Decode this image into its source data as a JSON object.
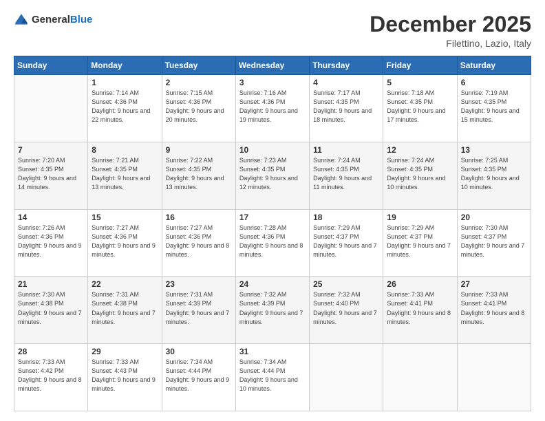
{
  "header": {
    "logo_general": "General",
    "logo_blue": "Blue",
    "month": "December 2025",
    "location": "Filettino, Lazio, Italy"
  },
  "days_of_week": [
    "Sunday",
    "Monday",
    "Tuesday",
    "Wednesday",
    "Thursday",
    "Friday",
    "Saturday"
  ],
  "weeks": [
    [
      {
        "day": "",
        "sunrise": "",
        "sunset": "",
        "daylight": ""
      },
      {
        "day": "1",
        "sunrise": "Sunrise: 7:14 AM",
        "sunset": "Sunset: 4:36 PM",
        "daylight": "Daylight: 9 hours and 22 minutes."
      },
      {
        "day": "2",
        "sunrise": "Sunrise: 7:15 AM",
        "sunset": "Sunset: 4:36 PM",
        "daylight": "Daylight: 9 hours and 20 minutes."
      },
      {
        "day": "3",
        "sunrise": "Sunrise: 7:16 AM",
        "sunset": "Sunset: 4:36 PM",
        "daylight": "Daylight: 9 hours and 19 minutes."
      },
      {
        "day": "4",
        "sunrise": "Sunrise: 7:17 AM",
        "sunset": "Sunset: 4:35 PM",
        "daylight": "Daylight: 9 hours and 18 minutes."
      },
      {
        "day": "5",
        "sunrise": "Sunrise: 7:18 AM",
        "sunset": "Sunset: 4:35 PM",
        "daylight": "Daylight: 9 hours and 17 minutes."
      },
      {
        "day": "6",
        "sunrise": "Sunrise: 7:19 AM",
        "sunset": "Sunset: 4:35 PM",
        "daylight": "Daylight: 9 hours and 15 minutes."
      }
    ],
    [
      {
        "day": "7",
        "sunrise": "Sunrise: 7:20 AM",
        "sunset": "Sunset: 4:35 PM",
        "daylight": "Daylight: 9 hours and 14 minutes."
      },
      {
        "day": "8",
        "sunrise": "Sunrise: 7:21 AM",
        "sunset": "Sunset: 4:35 PM",
        "daylight": "Daylight: 9 hours and 13 minutes."
      },
      {
        "day": "9",
        "sunrise": "Sunrise: 7:22 AM",
        "sunset": "Sunset: 4:35 PM",
        "daylight": "Daylight: 9 hours and 13 minutes."
      },
      {
        "day": "10",
        "sunrise": "Sunrise: 7:23 AM",
        "sunset": "Sunset: 4:35 PM",
        "daylight": "Daylight: 9 hours and 12 minutes."
      },
      {
        "day": "11",
        "sunrise": "Sunrise: 7:24 AM",
        "sunset": "Sunset: 4:35 PM",
        "daylight": "Daylight: 9 hours and 11 minutes."
      },
      {
        "day": "12",
        "sunrise": "Sunrise: 7:24 AM",
        "sunset": "Sunset: 4:35 PM",
        "daylight": "Daylight: 9 hours and 10 minutes."
      },
      {
        "day": "13",
        "sunrise": "Sunrise: 7:25 AM",
        "sunset": "Sunset: 4:35 PM",
        "daylight": "Daylight: 9 hours and 10 minutes."
      }
    ],
    [
      {
        "day": "14",
        "sunrise": "Sunrise: 7:26 AM",
        "sunset": "Sunset: 4:36 PM",
        "daylight": "Daylight: 9 hours and 9 minutes."
      },
      {
        "day": "15",
        "sunrise": "Sunrise: 7:27 AM",
        "sunset": "Sunset: 4:36 PM",
        "daylight": "Daylight: 9 hours and 9 minutes."
      },
      {
        "day": "16",
        "sunrise": "Sunrise: 7:27 AM",
        "sunset": "Sunset: 4:36 PM",
        "daylight": "Daylight: 9 hours and 8 minutes."
      },
      {
        "day": "17",
        "sunrise": "Sunrise: 7:28 AM",
        "sunset": "Sunset: 4:36 PM",
        "daylight": "Daylight: 9 hours and 8 minutes."
      },
      {
        "day": "18",
        "sunrise": "Sunrise: 7:29 AM",
        "sunset": "Sunset: 4:37 PM",
        "daylight": "Daylight: 9 hours and 7 minutes."
      },
      {
        "day": "19",
        "sunrise": "Sunrise: 7:29 AM",
        "sunset": "Sunset: 4:37 PM",
        "daylight": "Daylight: 9 hours and 7 minutes."
      },
      {
        "day": "20",
        "sunrise": "Sunrise: 7:30 AM",
        "sunset": "Sunset: 4:37 PM",
        "daylight": "Daylight: 9 hours and 7 minutes."
      }
    ],
    [
      {
        "day": "21",
        "sunrise": "Sunrise: 7:30 AM",
        "sunset": "Sunset: 4:38 PM",
        "daylight": "Daylight: 9 hours and 7 minutes."
      },
      {
        "day": "22",
        "sunrise": "Sunrise: 7:31 AM",
        "sunset": "Sunset: 4:38 PM",
        "daylight": "Daylight: 9 hours and 7 minutes."
      },
      {
        "day": "23",
        "sunrise": "Sunrise: 7:31 AM",
        "sunset": "Sunset: 4:39 PM",
        "daylight": "Daylight: 9 hours and 7 minutes."
      },
      {
        "day": "24",
        "sunrise": "Sunrise: 7:32 AM",
        "sunset": "Sunset: 4:39 PM",
        "daylight": "Daylight: 9 hours and 7 minutes."
      },
      {
        "day": "25",
        "sunrise": "Sunrise: 7:32 AM",
        "sunset": "Sunset: 4:40 PM",
        "daylight": "Daylight: 9 hours and 7 minutes."
      },
      {
        "day": "26",
        "sunrise": "Sunrise: 7:33 AM",
        "sunset": "Sunset: 4:41 PM",
        "daylight": "Daylight: 9 hours and 8 minutes."
      },
      {
        "day": "27",
        "sunrise": "Sunrise: 7:33 AM",
        "sunset": "Sunset: 4:41 PM",
        "daylight": "Daylight: 9 hours and 8 minutes."
      }
    ],
    [
      {
        "day": "28",
        "sunrise": "Sunrise: 7:33 AM",
        "sunset": "Sunset: 4:42 PM",
        "daylight": "Daylight: 9 hours and 8 minutes."
      },
      {
        "day": "29",
        "sunrise": "Sunrise: 7:33 AM",
        "sunset": "Sunset: 4:43 PM",
        "daylight": "Daylight: 9 hours and 9 minutes."
      },
      {
        "day": "30",
        "sunrise": "Sunrise: 7:34 AM",
        "sunset": "Sunset: 4:44 PM",
        "daylight": "Daylight: 9 hours and 9 minutes."
      },
      {
        "day": "31",
        "sunrise": "Sunrise: 7:34 AM",
        "sunset": "Sunset: 4:44 PM",
        "daylight": "Daylight: 9 hours and 10 minutes."
      },
      {
        "day": "",
        "sunrise": "",
        "sunset": "",
        "daylight": ""
      },
      {
        "day": "",
        "sunrise": "",
        "sunset": "",
        "daylight": ""
      },
      {
        "day": "",
        "sunrise": "",
        "sunset": "",
        "daylight": ""
      }
    ]
  ]
}
